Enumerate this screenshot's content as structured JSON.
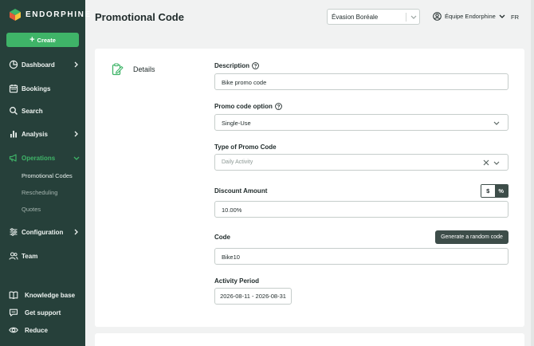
{
  "brand": {
    "name": "ENDORPHINE",
    "colors": {
      "sidebar": "#26403a",
      "accent": "#3fb468",
      "dark_button": "#3d4d49"
    }
  },
  "sidebar": {
    "create_label": "Create",
    "items": [
      {
        "label": "Dashboard",
        "icon": "pie-chart-icon"
      },
      {
        "label": "Bookings",
        "icon": "calendar-icon"
      },
      {
        "label": "Search",
        "icon": "search-icon"
      },
      {
        "label": "Analysis",
        "icon": "bar-chart-icon"
      },
      {
        "label": "Operations",
        "icon": "megaphone-icon"
      },
      {
        "label": "Configuration",
        "icon": "sliders-icon"
      },
      {
        "label": "Team",
        "icon": "users-icon"
      }
    ],
    "sub_items": [
      "Promotional Codes",
      "Rescheduling",
      "Quotes"
    ],
    "bottom": [
      {
        "label": "Knowledge base",
        "icon": "book-icon"
      },
      {
        "label": "Get support",
        "icon": "chat-icon"
      },
      {
        "label": "Reduce",
        "icon": "eye-icon"
      }
    ]
  },
  "header": {
    "title": "Promotional Code",
    "org_select": "Évasion Boréale",
    "user": "Équipe Endorphine",
    "lang": "FR"
  },
  "form": {
    "section_title": "Details",
    "description": {
      "label": "Description",
      "value": "Bike promo code"
    },
    "promo_option": {
      "label": "Promo code option",
      "value": "Single-Use"
    },
    "promo_type": {
      "label": "Type of Promo Code",
      "value": "Daily Activity"
    },
    "discount": {
      "label": "Discount Amount",
      "value": "10.00%",
      "unit_dollar": "$",
      "unit_percent": "%",
      "selected_unit": "%"
    },
    "code": {
      "label": "Code",
      "value": "Bike10",
      "generate_label": "Generate a random code"
    },
    "period": {
      "label": "Activity Period",
      "value": "2026-08-11 - 2026-08-31"
    }
  }
}
